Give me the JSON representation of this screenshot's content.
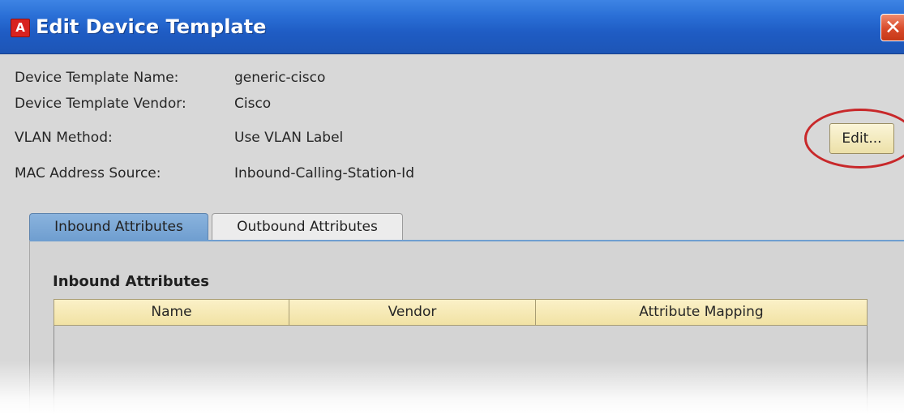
{
  "window": {
    "title": "Edit Device Template",
    "app_icon_glyph": "A",
    "close_glyph": "✕"
  },
  "fields": [
    {
      "label": "Device Template Name:",
      "value": "generic-cisco"
    },
    {
      "label": "Device Template Vendor:",
      "value": "Cisco"
    },
    {
      "label": "VLAN Method:",
      "value": "Use VLAN Label"
    },
    {
      "label": "MAC Address Source:",
      "value": "Inbound-Calling-Station-Id"
    }
  ],
  "edit_button": {
    "label": "Edit..."
  },
  "tabs": [
    {
      "label": "Inbound Attributes",
      "selected": true
    },
    {
      "label": "Outbound Attributes",
      "selected": false
    }
  ],
  "panel": {
    "title": "Inbound Attributes",
    "columns": [
      "Name",
      "Vendor",
      "Attribute Mapping"
    ],
    "rows": []
  },
  "colors": {
    "titlebar": "#2a6fd6",
    "dialog_bg": "#d8d8d8",
    "selected_tab": "#6f9ed0",
    "table_header": "#f1e2a4",
    "highlight_ring": "#c8282a"
  }
}
